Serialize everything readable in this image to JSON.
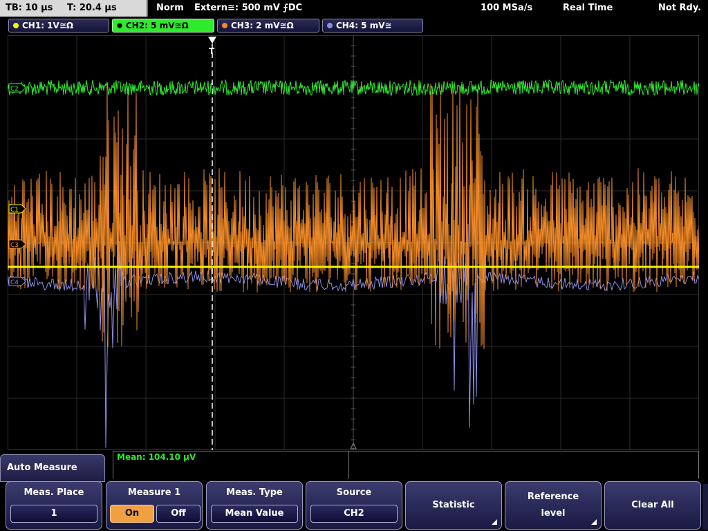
{
  "status_bar": {
    "timebase": "TB: 10 µs",
    "trigger_time": "T: 20.4 µs",
    "mode": "Norm",
    "trigger_source": "Extern≅: 500 mV ⨍DC",
    "sample_rate": "100 MSa/s",
    "acq_mode": "Real Time",
    "state": "Not Rdy."
  },
  "channels": [
    {
      "label": "CH1: 1V≅Ω",
      "color": "#f5f500",
      "active": false
    },
    {
      "label": "CH2: 5 mV≅Ω",
      "color": "#2eeb2e",
      "active": true
    },
    {
      "label": "CH3: 2 mV≅Ω",
      "color": "#f08a28",
      "active": false
    },
    {
      "label": "CH4: 5 mV≅",
      "color": "#8f8fe8",
      "active": false
    }
  ],
  "markers": {
    "ch2": "C2",
    "ch1": "C1",
    "ch3": "C3",
    "ch4": "C4",
    "trigger": "T"
  },
  "measurement": {
    "result": "Mean: 104.10 µV"
  },
  "menu": {
    "title": "Auto Measure",
    "softkeys": [
      {
        "label": "Meas. Place",
        "value": "1"
      },
      {
        "label": "Measure 1",
        "on": "On",
        "off": "Off"
      },
      {
        "label": "Meas. Type",
        "value": "Mean Value"
      },
      {
        "label": "Source",
        "value": "CH2"
      },
      {
        "label": "Statistic"
      },
      {
        "label_line1": "Reference",
        "label_line2": "level"
      },
      {
        "label": "Clear All"
      }
    ]
  }
}
